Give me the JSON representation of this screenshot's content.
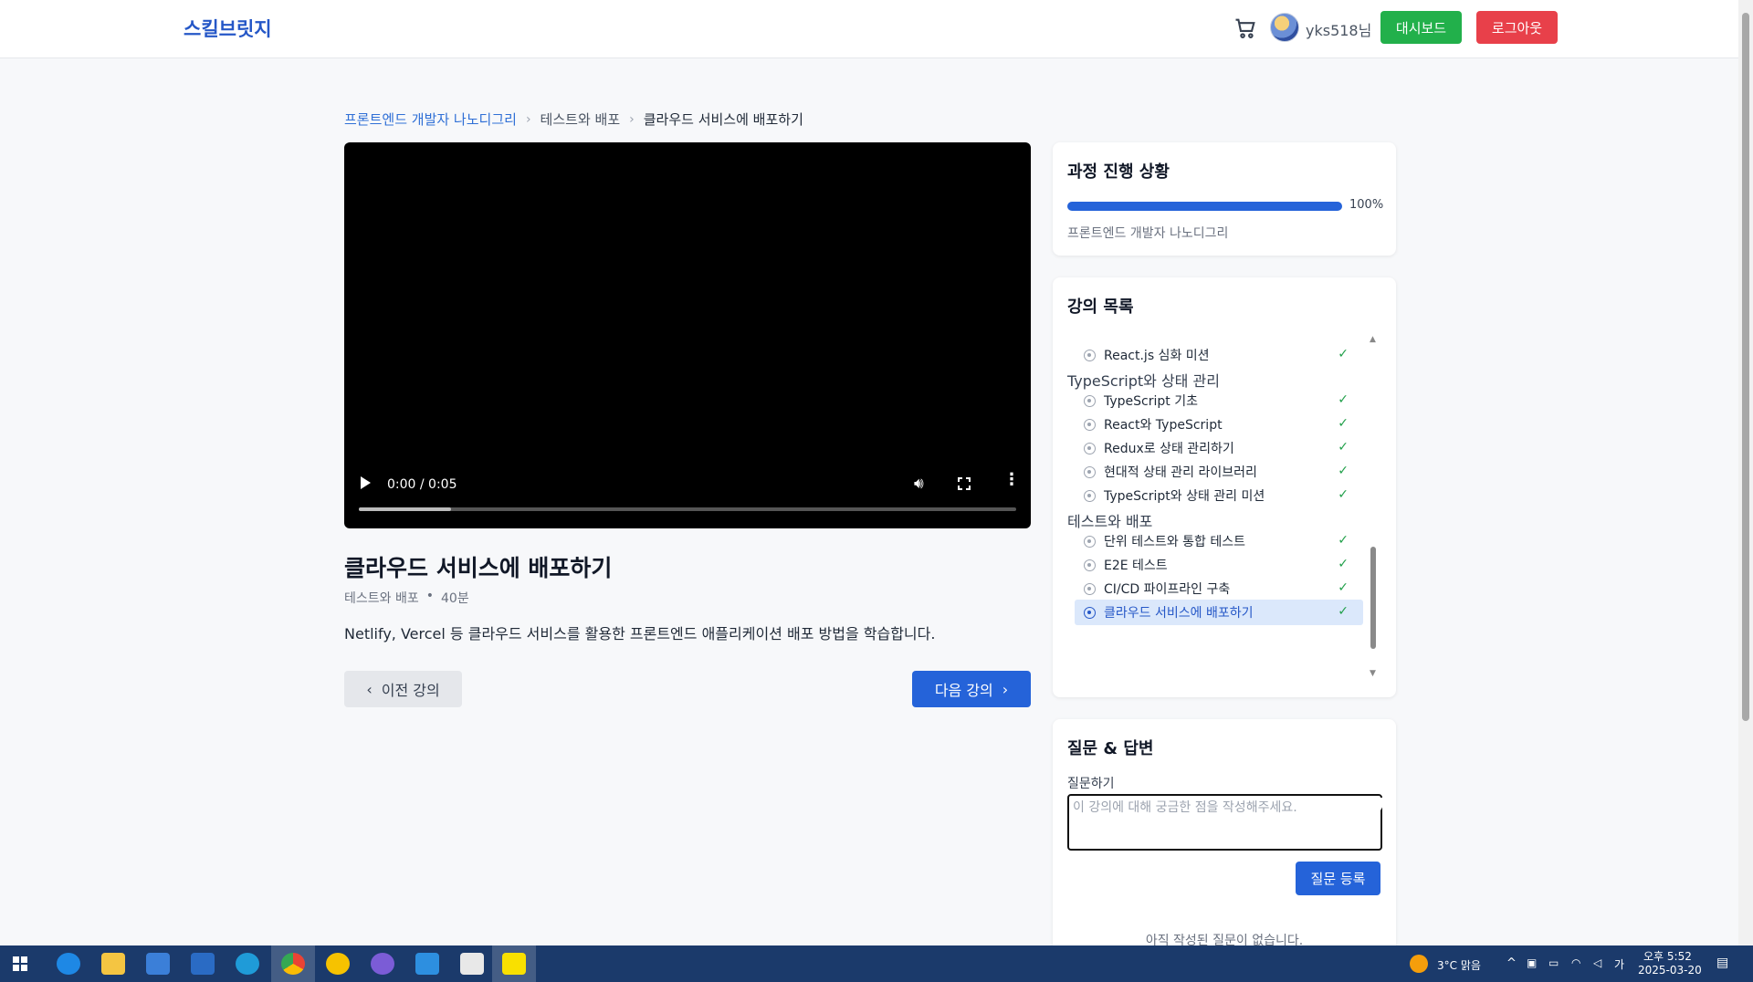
{
  "header": {
    "logo": "스킬브릿지",
    "username": "yks518님",
    "dashboard_label": "대시보드",
    "logout_label": "로그아웃"
  },
  "breadcrumb": {
    "course": "프론트엔드 개발자 나노디그리",
    "section": "테스트와 배포",
    "current": "클라우드 서비스에 배포하기"
  },
  "video": {
    "time": "0:00 / 0:05",
    "buffered_fraction": 0.14
  },
  "lecture": {
    "title": "클라우드 서비스에 배포하기",
    "section": "테스트와 배포",
    "duration": "40분",
    "description": "Netlify, Vercel 등 클라우드 서비스를 활용한 프론트엔드 애플리케이션 배포 방법을 학습합니다.",
    "prev_label": "이전 강의",
    "next_label": "다음 강의"
  },
  "progress": {
    "title": "과정 진행 상황",
    "percent": 100,
    "percent_label": "100%",
    "course_name": "프론트엔드 개발자 나노디그리"
  },
  "lecture_list": {
    "title": "강의 목록",
    "rows": [
      {
        "kind": "item",
        "label": "React.js 심화 미션",
        "completed": true,
        "active": false
      },
      {
        "kind": "section",
        "label": "TypeScript와 상태 관리"
      },
      {
        "kind": "item",
        "label": "TypeScript 기초",
        "completed": true,
        "active": false
      },
      {
        "kind": "item",
        "label": "React와 TypeScript",
        "completed": true,
        "active": false
      },
      {
        "kind": "item",
        "label": "Redux로 상태 관리하기",
        "completed": true,
        "active": false
      },
      {
        "kind": "item",
        "label": "현대적 상태 관리 라이브러리",
        "completed": true,
        "active": false
      },
      {
        "kind": "item",
        "label": "TypeScript와 상태 관리 미션",
        "completed": true,
        "active": false
      },
      {
        "kind": "section",
        "label": "테스트와 배포"
      },
      {
        "kind": "item",
        "label": "단위 테스트와 통합 테스트",
        "completed": true,
        "active": false
      },
      {
        "kind": "item",
        "label": "E2E 테스트",
        "completed": true,
        "active": false
      },
      {
        "kind": "item",
        "label": "CI/CD 파이프라인 구축",
        "completed": true,
        "active": false
      },
      {
        "kind": "item",
        "label": "클라우드 서비스에 배포하기",
        "completed": true,
        "active": true
      }
    ]
  },
  "qa": {
    "title": "질문 & 답변",
    "label": "질문하기",
    "placeholder": "이 강의에 대해 궁금한 점을 작성해주세요.",
    "submit_label": "질문 등록",
    "empty_text": "아직 작성된 질문이 없습니다."
  },
  "taskbar": {
    "weather": "3°C 맑음",
    "ime": "가",
    "time": "오후 5:52",
    "date": "2025-03-20"
  },
  "colors": {
    "primary": "#2563d9",
    "success": "#22b04b",
    "danger": "#e8404a",
    "check": "#22a04b"
  }
}
